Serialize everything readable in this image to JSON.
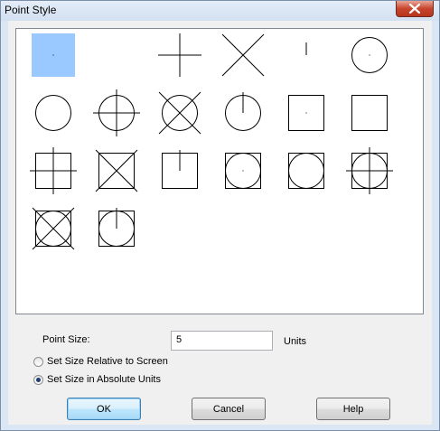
{
  "window": {
    "title": "Point Style"
  },
  "point_styles": [
    {
      "name": "dot",
      "selected": true
    },
    {
      "name": "none"
    },
    {
      "name": "plus"
    },
    {
      "name": "x"
    },
    {
      "name": "tick"
    },
    {
      "name": "circle-dot"
    },
    {
      "name": "circle"
    },
    {
      "name": "circle-plus"
    },
    {
      "name": "circle-x"
    },
    {
      "name": "circle-tick"
    },
    {
      "name": "square-dot"
    },
    {
      "name": "square"
    },
    {
      "name": "square-plus"
    },
    {
      "name": "square-x"
    },
    {
      "name": "square-tick"
    },
    {
      "name": "square-circle-dot"
    },
    {
      "name": "square-circle"
    },
    {
      "name": "square-circle-plus"
    },
    {
      "name": "square-circle-x"
    },
    {
      "name": "square-circle-tick"
    }
  ],
  "form": {
    "point_size_label": "Point Size:",
    "point_size_value": "5",
    "units_label": "Units",
    "relative_label": "Set Size Relative to Screen",
    "absolute_label": "Set Size in Absolute Units",
    "selected_mode": "absolute"
  },
  "buttons": {
    "ok": "OK",
    "cancel": "Cancel",
    "help": "Help"
  }
}
